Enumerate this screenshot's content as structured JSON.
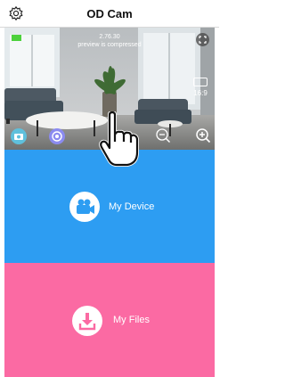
{
  "header": {
    "title": "OD Cam"
  },
  "preview": {
    "status_line1": "2.76.30",
    "status_line2": "preview is compressed",
    "aspect_label": "16:9"
  },
  "menu": {
    "device_label": "My Device",
    "files_label": "My Files"
  },
  "colors": {
    "device_panel": "#2d9df2",
    "files_panel": "#fb6aa3",
    "record": "#ff2a2a",
    "battery": "#4cd13c"
  },
  "icons": {
    "settings": "gear-icon",
    "fullscreen": "expand-icon",
    "camera": "camera-icon",
    "capture": "shutter-icon",
    "record": "record-icon",
    "zoom_out": "zoom-out-icon",
    "zoom_in": "zoom-in-icon",
    "device": "video-camera-icon",
    "files": "download-icon"
  }
}
